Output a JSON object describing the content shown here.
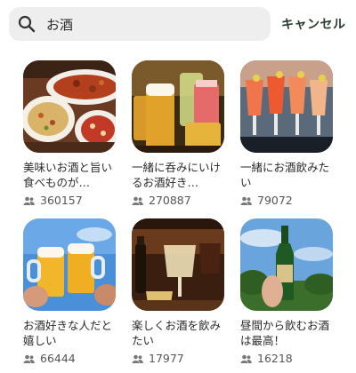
{
  "search": {
    "query": "お酒",
    "cancel_label": "キャンセル"
  },
  "colors": {
    "search_bg": "#eeeeef",
    "cancel_text": "#2a3d33",
    "count_icon": "#777777"
  },
  "results": [
    {
      "title": "美味いお酒と旨い食べものが…",
      "members": "360157",
      "image": "dishes-platter"
    },
    {
      "title": "一緒に呑みにいけるお酒好き…",
      "members": "270887",
      "image": "beer-and-cocktails"
    },
    {
      "title": "一緒にお酒飲みたい",
      "members": "79072",
      "image": "cocktail-glasses"
    },
    {
      "title": "お酒好きな人だと嬉しい",
      "members": "66444",
      "image": "beer-mugs-toast"
    },
    {
      "title": "楽しくお酒を飲みたい",
      "members": "17977",
      "image": "wine-glasses-bar"
    },
    {
      "title": "昼間から飲むお酒は最高！",
      "members": "16218",
      "image": "beer-bottle-sky"
    }
  ]
}
